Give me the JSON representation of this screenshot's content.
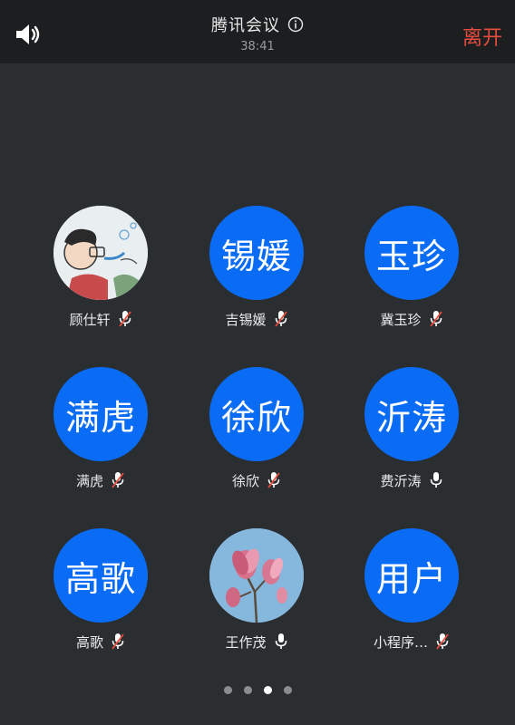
{
  "header": {
    "title": "腾讯会议",
    "timer": "38:41",
    "leave_label": "离开"
  },
  "participants": [
    {
      "avatar_text": "",
      "name": "顾仕轩",
      "mic": "muted",
      "avatar": "cartoon-photo"
    },
    {
      "avatar_text": "锡媛",
      "name": "吉锡媛",
      "mic": "muted"
    },
    {
      "avatar_text": "玉珍",
      "name": "冀玉珍",
      "mic": "muted"
    },
    {
      "avatar_text": "满虎",
      "name": "满虎",
      "mic": "muted"
    },
    {
      "avatar_text": "徐欣",
      "name": "徐欣",
      "mic": "muted"
    },
    {
      "avatar_text": "沂涛",
      "name": "费沂涛",
      "mic": "on"
    },
    {
      "avatar_text": "高歌",
      "name": "高歌",
      "mic": "muted"
    },
    {
      "avatar_text": "",
      "name": "王作茂",
      "mic": "on",
      "avatar": "flower-photo"
    },
    {
      "avatar_text": "用户",
      "name": "小程序…",
      "mic": "muted"
    }
  ],
  "pagination": {
    "pages": 4,
    "current": 3
  },
  "colors": {
    "background": "#2b2e31",
    "header": "#1c1e20",
    "avatar_blue": "#0a6cf5",
    "leave_red": "#e74c3c",
    "muted_red": "#e74c3c"
  }
}
